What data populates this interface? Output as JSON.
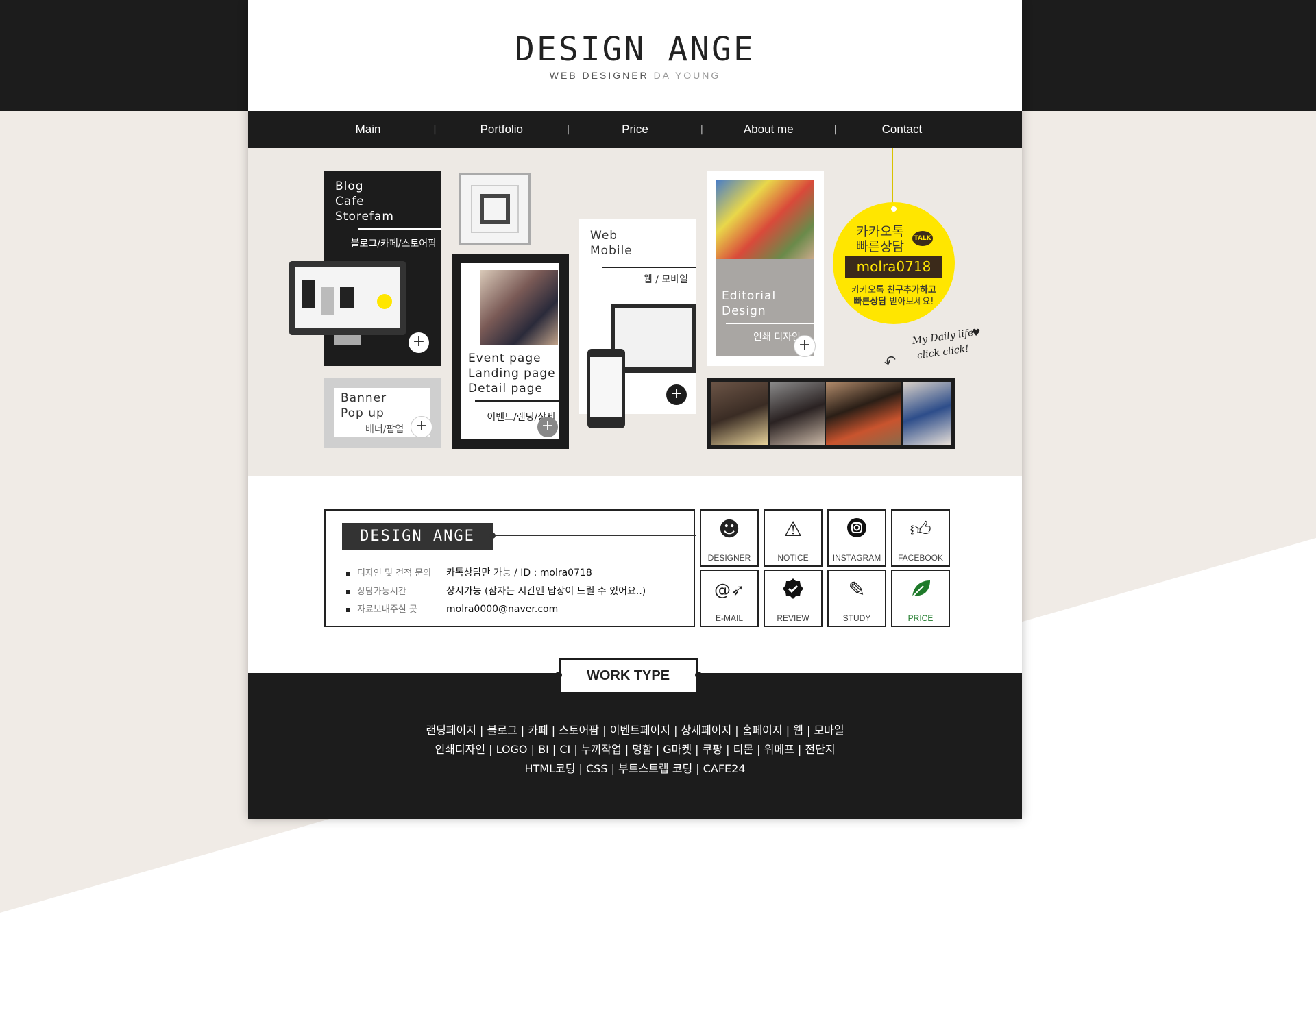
{
  "header": {
    "logo": "DESIGN ANGE",
    "subtitle_main": "WEB DESIGNER",
    "subtitle_light": "DA YOUNG"
  },
  "nav": {
    "items": [
      "Main",
      "Portfolio",
      "Price",
      "About me",
      "Contact"
    ],
    "separator": "|"
  },
  "hero": {
    "blog": {
      "title": "Blog\nCafe\nStorefam",
      "kr": "블로그/카페/스토어팜",
      "plus": "+"
    },
    "banner": {
      "title": "Banner\nPop up",
      "kr": "배너/팝업",
      "plus": "+"
    },
    "event": {
      "title": "Event page\nLanding page\nDetail page",
      "kr": "이벤트/랜딩/상세",
      "plus": "+"
    },
    "web": {
      "title": "Web\nMobile",
      "kr": "웹 / 모바일",
      "plus": "+"
    },
    "editorial": {
      "title": "Editorial\nDesign",
      "kr": "인쇄 디자인",
      "plus": "+"
    },
    "kakao": {
      "line1": "카카오톡",
      "line2": "빠른상담",
      "talk": "TALK",
      "id": "molra0718",
      "desc1_a": "카카오톡",
      "desc1_b": "친구추가하고",
      "desc2_a": "빠른상담",
      "desc2_b": "받아보세요!"
    },
    "daily": {
      "line1": "My Daily life",
      "line2": "click click!"
    }
  },
  "info": {
    "logo": "DESIGN ANGE",
    "rows": [
      {
        "key": "디자인 및 견적 문의",
        "value": "카톡상담만 가능 / ID : molra0718"
      },
      {
        "key": "상담가능시간",
        "value": "상시가능 (잠자는 시간엔 답장이 느릴 수 있어요..)"
      },
      {
        "key": "자료보내주실 곳",
        "value": "molra0000@naver.com"
      }
    ]
  },
  "icons": [
    {
      "label": "DESIGNER",
      "icon": "face-icon"
    },
    {
      "label": "NOTICE",
      "icon": "warning-icon"
    },
    {
      "label": "INSTAGRAM",
      "icon": "instagram-icon"
    },
    {
      "label": "FACEBOOK",
      "icon": "thumbs-up-icon"
    },
    {
      "label": "E-MAIL",
      "icon": "email-plane-icon"
    },
    {
      "label": "REVIEW",
      "icon": "check-badge-icon"
    },
    {
      "label": "STUDY",
      "icon": "pencil-icon"
    },
    {
      "label": "PRICE",
      "icon": "leaf-icon",
      "color": "#1e7a2a"
    }
  ],
  "work_type": {
    "title": "WORK TYPE",
    "line1": "랜딩페이지 | 블로그 | 카페 | 스토어팜 | 이벤트페이지 | 상세페이지 | 홈페이지 | 웹 | 모바일",
    "line2": "인쇄디자인 | LOGO | BI | CI | 누끼작업 | 명함 | G마켓 | 쿠팡 | 티몬 | 위메프 | 전단지",
    "line3": "HTML코딩 | CSS | 부트스트랩 코딩 | CAFE24"
  },
  "colors": {
    "dark": "#1c1c1c",
    "beige": "#f0ebe6",
    "kakao_yellow": "#ffe600",
    "price_green": "#1e7a2a"
  }
}
